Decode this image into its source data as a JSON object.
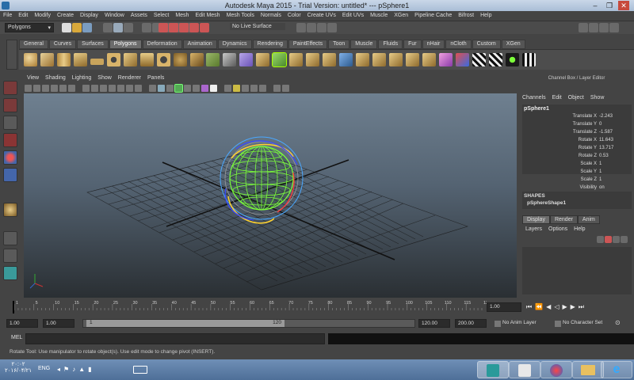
{
  "window": {
    "title": "Autodesk Maya 2015 - Trial Version: untitled*   ---   pSphere1",
    "min": "–",
    "max": "❐",
    "close": "✕"
  },
  "menubar": [
    "File",
    "Edit",
    "Modify",
    "Create",
    "Display",
    "Window",
    "Assets",
    "Select",
    "Mesh",
    "Edit Mesh",
    "Mesh Tools",
    "Normals",
    "Color",
    "Create UVs",
    "Edit UVs",
    "Muscle",
    "XGen",
    "Pipeline Cache",
    "Bifrost",
    "Help"
  ],
  "statusline": {
    "menu_set": "Polygons",
    "live_surface": "No Live Surface"
  },
  "shelf_tabs": [
    "General",
    "Curves",
    "Surfaces",
    "Polygons",
    "Deformation",
    "Animation",
    "Dynamics",
    "Rendering",
    "PaintEffects",
    "Toon",
    "Muscle",
    "Fluids",
    "Fur",
    "nHair",
    "nCloth",
    "Custom",
    "XGen"
  ],
  "shelf_active": "Polygons",
  "viewport_menu": [
    "View",
    "Shading",
    "Lighting",
    "Show",
    "Renderer",
    "Panels"
  ],
  "channel_box": {
    "header": "Channel Box / Layer Editor",
    "menu": [
      "Channels",
      "Edit",
      "Object",
      "Show"
    ],
    "object": "pSphere1",
    "attributes": [
      {
        "name": "Translate X",
        "value": "-2.243"
      },
      {
        "name": "Translate Y",
        "value": "0"
      },
      {
        "name": "Translate Z",
        "value": "-1.587"
      },
      {
        "name": "Rotate X",
        "value": "11.643"
      },
      {
        "name": "Rotate Y",
        "value": "13.717"
      },
      {
        "name": "Rotate Z",
        "value": "0.53"
      },
      {
        "name": "Scale X",
        "value": "1"
      },
      {
        "name": "Scale Y",
        "value": "1"
      },
      {
        "name": "Scale Z",
        "value": "1"
      },
      {
        "name": "Visibility",
        "value": "on"
      }
    ],
    "shapes_label": "SHAPES",
    "shape_name": "pSphereShape1"
  },
  "layer_editor": {
    "tabs": [
      "Display",
      "Render",
      "Anim"
    ],
    "active_tab": "Display",
    "menu": [
      "Layers",
      "Options",
      "Help"
    ]
  },
  "time_slider": {
    "ticks": [
      "1",
      "5",
      "10",
      "15",
      "20",
      "25",
      "30",
      "35",
      "40",
      "45",
      "50",
      "55",
      "60",
      "65",
      "70",
      "75",
      "80",
      "85",
      "90",
      "95",
      "100",
      "105",
      "110",
      "115",
      "12"
    ],
    "current_frame": "1.00"
  },
  "range_slider": {
    "start": "1.00",
    "playback_start": "1.00",
    "range_start_label": "1",
    "range_end_label": "120",
    "playback_end": "120.00",
    "end": "200.00",
    "anim_layer": "No Anim Layer",
    "character_set": "No Character Set"
  },
  "mel_label": "MEL",
  "help_line": "Rotate Tool: Use manipulator to rotate object(s). Use edit mode to change pivot (INSERT).",
  "taskbar": {
    "clock_time": "۲۰:۰۲",
    "clock_date": "۲۰۱۶/۰۴/۲۱",
    "language": "ENG"
  },
  "colors": {
    "ui_bg": "#444444",
    "wire_green": "#7cff3a",
    "manip_blue": "#4aa8ff",
    "manip_yellow": "#ffd22e"
  }
}
